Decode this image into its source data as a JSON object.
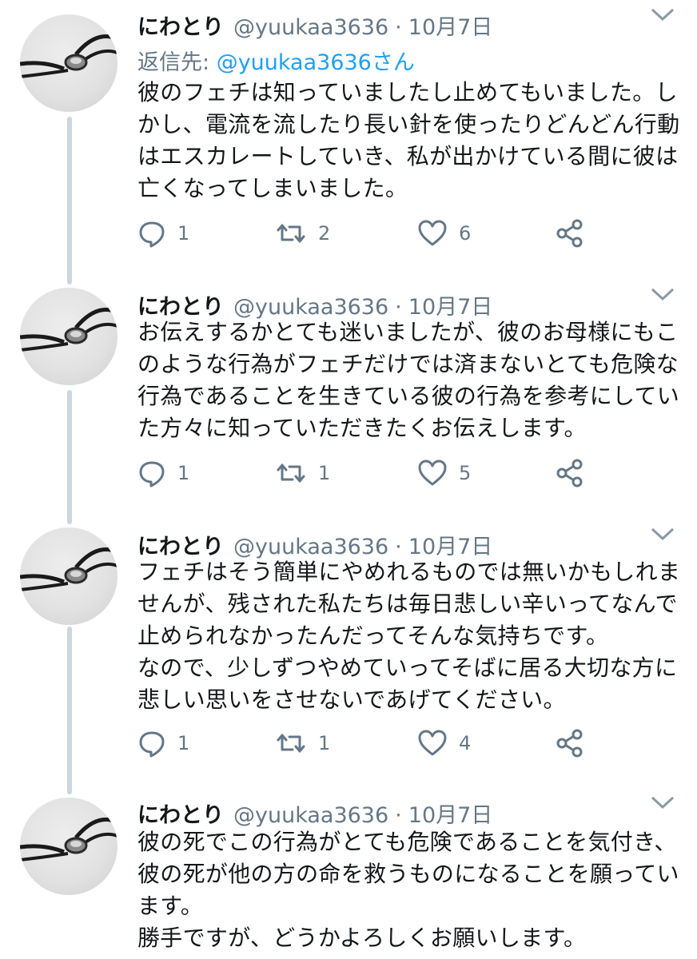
{
  "icons": {
    "chevron": "chevron-down-icon",
    "reply": "reply-icon",
    "retweet": "retweet-icon",
    "like": "heart-icon",
    "share": "share-icon"
  },
  "colors": {
    "secondary_text": "#657786",
    "link": "#1da1f2",
    "thread_line": "#ccd6dd"
  },
  "reply_label": "返信先: ",
  "reply_to_handle": "@yuukaa3636さん",
  "tweets": [
    {
      "name": "にわとり",
      "handle": "@yuukaa3636",
      "date": "10月7日",
      "text": "彼のフェチは知っていましたし止めてもいました。しかし、電流を流したり長い針を使ったりどんどん行動はエスカレートしていき、私が出かけている間に彼は亡くなってしまいました。",
      "replies": "1",
      "retweets": "2",
      "likes": "6"
    },
    {
      "name": "にわとり",
      "handle": "@yuukaa3636",
      "date": "10月7日",
      "text": "お伝えするかとても迷いましたが、彼のお母様にもこのような行為がフェチだけでは済まないとても危険な行為であることを生きている彼の行為を参考にしていた方々に知っていただきたくお伝えします。",
      "replies": "1",
      "retweets": "1",
      "likes": "5"
    },
    {
      "name": "にわとり",
      "handle": "@yuukaa3636",
      "date": "10月7日",
      "text": "フェチはそう簡単にやめれるものでは無いかもしれませんが、残された私たちは毎日悲しい辛いってなんで止められなかったんだってそんな気持ちです。\nなので、少しずつやめていってそばに居る大切な方に悲しい思いをさせないであげてください。",
      "replies": "1",
      "retweets": "1",
      "likes": "4"
    },
    {
      "name": "にわとり",
      "handle": "@yuukaa3636",
      "date": "10月7日",
      "text": "彼の死でこの行為がとても危険であることを気付き、彼の死が他の方の命を救うものになることを願っています。\n勝手ですが、どうかよろしくお願いします。"
    }
  ]
}
